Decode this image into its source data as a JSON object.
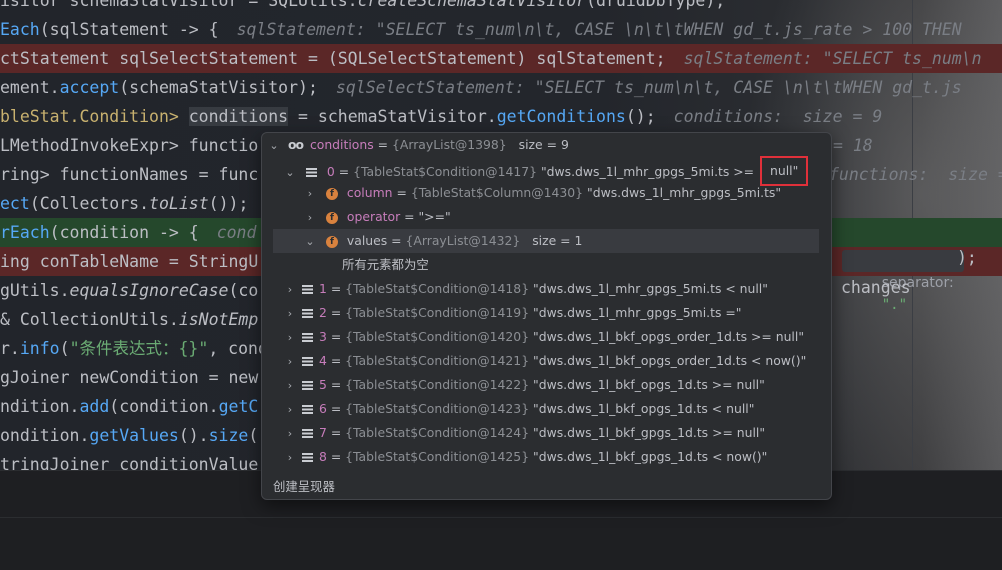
{
  "editor": {
    "lines": [
      {
        "segments": [
          {
            "t": "isitor schemaStatVisitor = SQLUtils.",
            "c": ""
          },
          {
            "t": "createSchemaStatVisitor",
            "c": "it"
          },
          {
            "t": "(druidDbType);",
            "c": ""
          }
        ]
      },
      {
        "segments": [
          {
            "t": "Each",
            "c": "fn"
          },
          {
            "t": "(sqlStatement -> {",
            "c": ""
          },
          {
            "t": "sqlStatement: \"SELECT ts_num\\n\\t, CASE \\n\\t\\tWHEN gd_t.js_rate > 100 THEN",
            "c": "hint"
          }
        ]
      },
      {
        "segments": [
          {
            "t": "ctStatement sqlSelectStatement = (SQLSelectStatement) sqlStatement;",
            "c": ""
          },
          {
            "t": "sqlStatement: \"SELECT ts_num\\n",
            "c": "hint"
          }
        ],
        "hl": "red"
      },
      {
        "segments": [
          {
            "t": "ement.",
            "c": ""
          },
          {
            "t": "accept",
            "c": "fn"
          },
          {
            "t": "(schemaStatVisitor);",
            "c": ""
          },
          {
            "t": "sqlSelectStatement: \"SELECT ts_num\\n\\t, CASE \\n\\t\\tWHEN gd_t.js",
            "c": "hint"
          }
        ]
      },
      {
        "segments": [
          {
            "t": "bleStat.Condition> ",
            "c": "ty"
          },
          {
            "t": "conditions",
            "c": "sel"
          },
          {
            "t": " = schemaStatVisitor.",
            "c": ""
          },
          {
            "t": "getConditions",
            "c": "fn"
          },
          {
            "t": "();",
            "c": ""
          },
          {
            "t": "conditions:  size = 9",
            "c": "hint"
          }
        ]
      },
      {
        "segments": [
          {
            "t": "LMethodInvokeExpr> functio",
            "c": ""
          },
          {
            "t": "= 18",
            "c": "hint2"
          }
        ]
      },
      {
        "segments": [
          {
            "t": "ring> functionNames = func",
            "c": ""
          },
          {
            "t": "functions:  size =",
            "c": "hint2b"
          }
        ]
      },
      {
        "segments": [
          {
            "t": "ect",
            "c": "fn"
          },
          {
            "t": "(Collectors.",
            "c": ""
          },
          {
            "t": "toList",
            "c": "it"
          },
          {
            "t": "());",
            "c": ""
          }
        ]
      },
      {
        "segments": [
          {
            "t": "rEach",
            "c": "fn"
          },
          {
            "t": "(condition -> {",
            "c": ""
          },
          {
            "t": "cond",
            "c": "hint"
          }
        ],
        "hl": "green"
      },
      {
        "segments": [
          {
            "t": "ing conTableName = StringU",
            "c": ""
          }
        ],
        "hl": "red"
      },
      {
        "segments": [
          {
            "t": "gUtils.",
            "c": ""
          },
          {
            "t": "equalsIgnoreCase",
            "c": "it"
          },
          {
            "t": "(co",
            "c": ""
          }
        ]
      },
      {
        "segments": [
          {
            "t": "& CollectionUtils.",
            "c": ""
          },
          {
            "t": "isNotEmp",
            "c": "it"
          }
        ]
      },
      {
        "segments": [
          {
            "t": "r.",
            "c": ""
          },
          {
            "t": "info",
            "c": "fn"
          },
          {
            "t": "(",
            "c": ""
          },
          {
            "t": "\"条件表达式：{}\"",
            "c": "st"
          },
          {
            "t": ", cond",
            "c": ""
          }
        ]
      },
      {
        "segments": [
          {
            "t": "gJoiner newCondition = new",
            "c": ""
          }
        ]
      },
      {
        "segments": [
          {
            "t": "ndition.",
            "c": ""
          },
          {
            "t": "add",
            "c": "fn"
          },
          {
            "t": "(condition.",
            "c": ""
          },
          {
            "t": "getC",
            "c": "fn"
          }
        ]
      },
      {
        "segments": [
          {
            "t": "ondition.",
            "c": ""
          },
          {
            "t": "getValues",
            "c": "fn"
          },
          {
            "t": "().",
            "c": ""
          },
          {
            "t": "size",
            "c": "fn"
          },
          {
            "t": "(",
            "c": ""
          }
        ]
      },
      {
        "segments": [
          {
            "t": "tringJoiner conditionValue",
            "c": ""
          }
        ]
      }
    ],
    "separator_hint": {
      "label": "separator:",
      "value": "\".\"",
      "tail": ");"
    },
    "changes_text": "changes"
  },
  "popup": {
    "root": {
      "name": "conditions",
      "ref": "{ArrayList@1398}",
      "size": "size = 9"
    },
    "item0": {
      "index": "0",
      "ref": "{TableStat$Condition@1417}",
      "value": "\"dws.dws_1l_mhr_gpgs_5mi.ts >=",
      "highlighted": "null\""
    },
    "fields": [
      {
        "name": "column",
        "ref": "{TableStat$Column@1430}",
        "value": "\"dws.dws_1l_mhr_gpgs_5mi.ts\""
      },
      {
        "name": "operator",
        "ref": "",
        "value": "\">=\""
      },
      {
        "name": "values",
        "ref": "{ArrayList@1432}",
        "value": "",
        "size": "size = 1"
      }
    ],
    "empty_message": "所有元素都为空",
    "items": [
      {
        "index": "1",
        "ref": "{TableStat$Condition@1418}",
        "value": "\"dws.dws_1l_mhr_gpgs_5mi.ts < null\""
      },
      {
        "index": "2",
        "ref": "{TableStat$Condition@1419}",
        "value": "\"dws.dws_1l_mhr_gpgs_5mi.ts =\""
      },
      {
        "index": "3",
        "ref": "{TableStat$Condition@1420}",
        "value": "\"dws.dws_1l_bkf_opgs_order_1d.ts >= null\""
      },
      {
        "index": "4",
        "ref": "{TableStat$Condition@1421}",
        "value": "\"dws.dws_1l_bkf_opgs_order_1d.ts < now()\""
      },
      {
        "index": "5",
        "ref": "{TableStat$Condition@1422}",
        "value": "\"dws.dws_1l_bkf_opgs_1d.ts >= null\""
      },
      {
        "index": "6",
        "ref": "{TableStat$Condition@1423}",
        "value": "\"dws.dws_1l_bkf_opgs_1d.ts < null\""
      },
      {
        "index": "7",
        "ref": "{TableStat$Condition@1424}",
        "value": "\"dws.dws_1l_bkf_gpgs_1d.ts >= null\""
      },
      {
        "index": "8",
        "ref": "{TableStat$Condition@1425}",
        "value": "\"dws.dws_1l_bkf_gpgs_1d.ts < now()\""
      }
    ],
    "create_renderer": "创建呈现器"
  },
  "colors": {
    "highlight_box": "#e0303a",
    "field_icon": "#d9823e",
    "var_name": "#c77dbb",
    "red_line": "#5b2727",
    "green_line": "#25482c"
  }
}
